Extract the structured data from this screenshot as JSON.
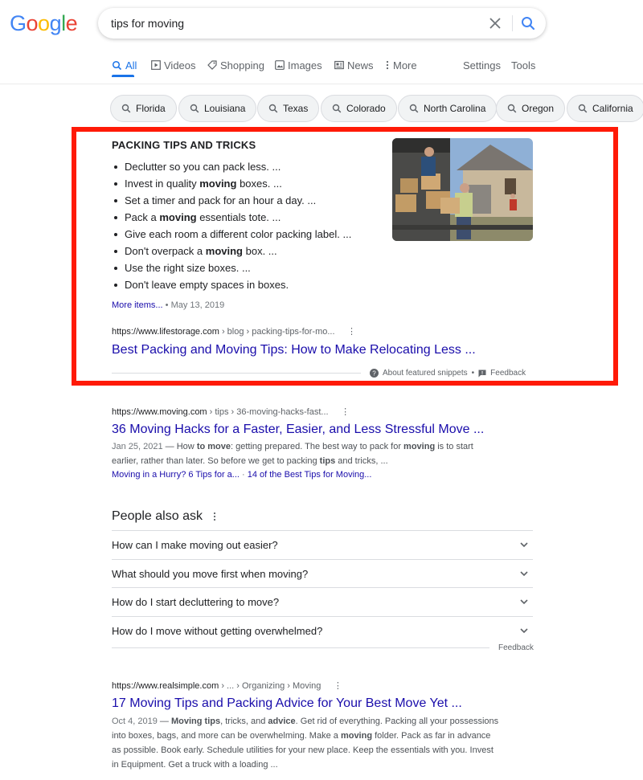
{
  "logo": {
    "letters": [
      {
        "ch": "G",
        "color": "#4285F4"
      },
      {
        "ch": "o",
        "color": "#EA4335"
      },
      {
        "ch": "o",
        "color": "#FBBC05"
      },
      {
        "ch": "g",
        "color": "#4285F4"
      },
      {
        "ch": "l",
        "color": "#34A853"
      },
      {
        "ch": "e",
        "color": "#EA4335"
      }
    ]
  },
  "search": {
    "query": "tips for moving"
  },
  "tabs": [
    {
      "label": "All",
      "icon": "search-icon",
      "active": true
    },
    {
      "label": "Videos",
      "icon": "video-icon"
    },
    {
      "label": "Shopping",
      "icon": "tag-icon"
    },
    {
      "label": "Images",
      "icon": "image-icon"
    },
    {
      "label": "News",
      "icon": "news-icon"
    },
    {
      "label": "More",
      "icon": "more-vert-icon"
    }
  ],
  "tools": {
    "settings": "Settings",
    "tools": "Tools"
  },
  "chips": [
    "Florida",
    "Louisiana",
    "Texas",
    "Colorado",
    "North Carolina",
    "Oregon",
    "California"
  ],
  "featured": {
    "heading": "PACKING TIPS AND TRICKS",
    "items": [
      {
        "before": "Declutter so you can pack less. ...",
        "bold": "",
        "after": ""
      },
      {
        "before": "Invest in quality ",
        "bold": "moving",
        "after": " boxes. ..."
      },
      {
        "before": "Set a timer and pack for an hour a day. ...",
        "bold": "",
        "after": ""
      },
      {
        "before": "Pack a ",
        "bold": "moving",
        "after": " essentials tote. ..."
      },
      {
        "before": "Give each room a different color packing label. ...",
        "bold": "",
        "after": ""
      },
      {
        "before": "Don't overpack a ",
        "bold": "moving",
        "after": " box. ..."
      },
      {
        "before": "Use the right size boxes. ...",
        "bold": "",
        "after": ""
      },
      {
        "before": "Don't leave empty spaces in boxes.",
        "bold": "",
        "after": ""
      }
    ],
    "more_items": "More items...",
    "date": "May 13, 2019",
    "url_host": "https://www.lifestorage.com",
    "url_path": " › blog › packing-tips-for-mo...",
    "title": "Best Packing and Moving Tips: How to Make Relocating Less ...",
    "about": "About featured snippets",
    "feedback": "Feedback",
    "accent": "#ff1a07"
  },
  "result1": {
    "url_host": "https://www.moving.com",
    "url_path": " › tips › 36-moving-hacks-fast...",
    "title": "36 Moving Hacks for a Faster, Easier, and Less Stressful Move ...",
    "date": "Jan 25, 2021",
    "s1": " — How ",
    "b1": "to move",
    "s2": ": getting prepared. The best way to pack for ",
    "b2": "moving",
    "s3": " is to start earlier, rather than later. So before we get to packing ",
    "b3": "tips",
    "s4": " and tricks, ...",
    "sublink1": "Moving in a Hurry? 6 Tips for a...",
    "sublink_sep": " · ",
    "sublink2": "14 of the Best Tips for Moving..."
  },
  "paa": {
    "title": "People also ask",
    "questions": [
      "How can I make moving out easier?",
      "What should you move first when moving?",
      "How do I start decluttering to move?",
      "How do I move without getting overwhelmed?"
    ],
    "feedback": "Feedback"
  },
  "result2": {
    "url_host": "https://www.realsimple.com",
    "url_path": " › ... › Organizing › Moving",
    "title": "17 Moving Tips and Packing Advice for Your Best Move Yet ...",
    "date": "Oct 4, 2019",
    "s1": " — ",
    "b1": "Moving tips",
    "s2": ", tricks, and ",
    "b2": "advice",
    "s3": ". Get rid of everything. Packing all your possessions into boxes, bags, and more can be overwhelming. Make a ",
    "b3": "moving",
    "s4": " folder. Pack as far in advance as possible. Book early. Schedule utilities for your new place. Keep the essentials with you. Invest in Equipment. Get a truck with a loading ..."
  }
}
